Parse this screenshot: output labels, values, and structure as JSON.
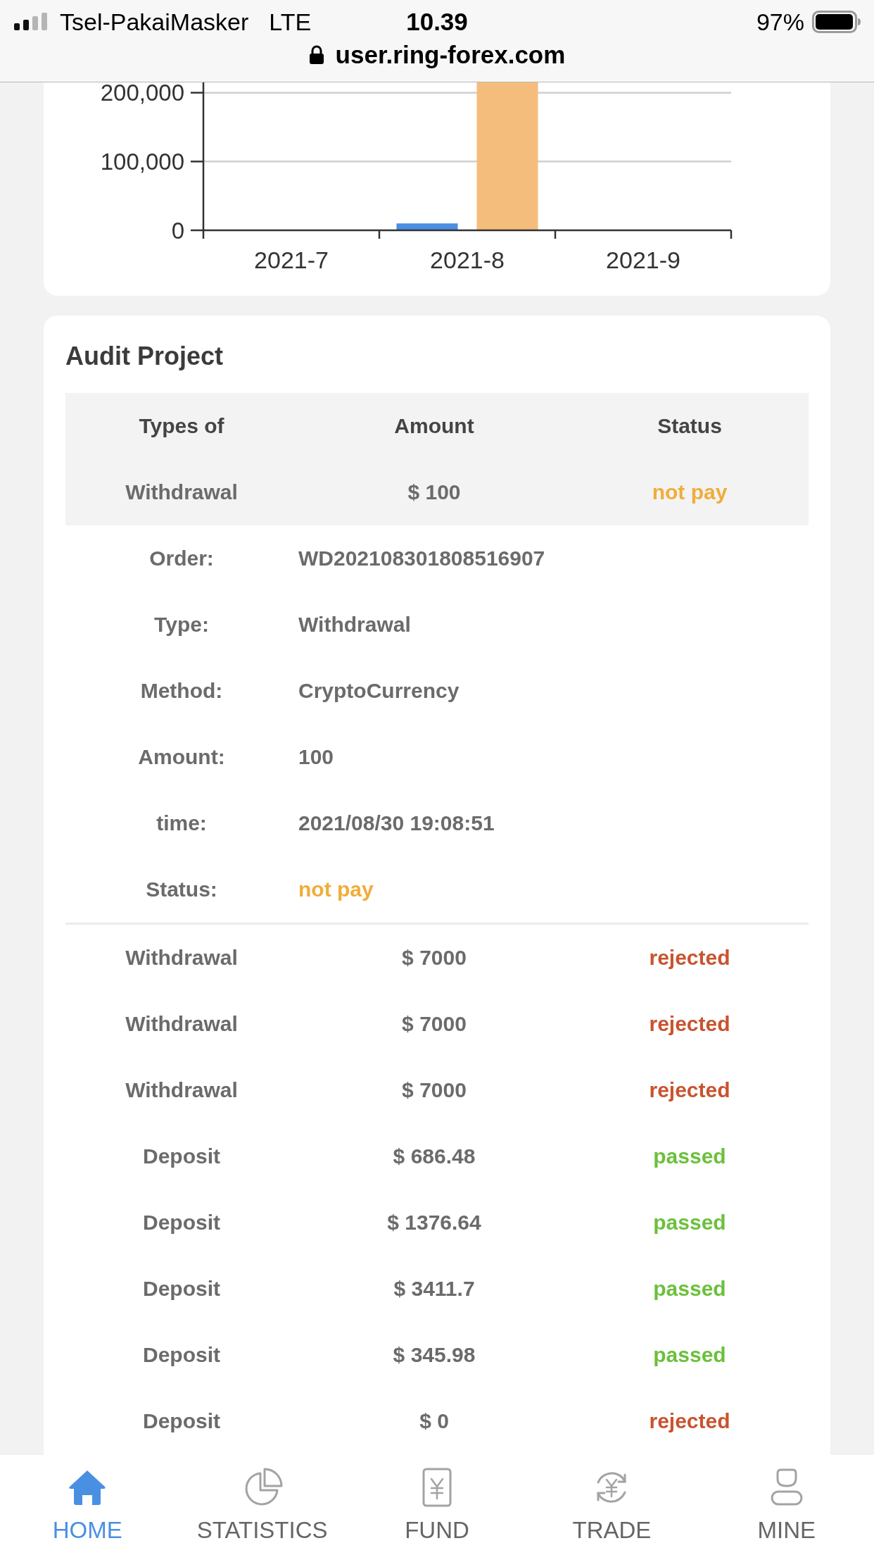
{
  "status_bar": {
    "carrier": "Tsel-PakaiMasker",
    "network": "LTE",
    "time": "10.39",
    "battery": "97%",
    "url": "user.ring-forex.com"
  },
  "chart_card": {
    "chart_data": {
      "type": "bar",
      "categories": [
        "2021-7",
        "2021-8",
        "2021-9"
      ],
      "series": [
        {
          "color": "#4a8fe0",
          "values": [
            null,
            10000,
            null
          ]
        },
        {
          "color": "#f5bd7b",
          "values": [
            null,
            215000,
            null
          ]
        }
      ],
      "ylim": [
        0,
        215000
      ],
      "yticks": [
        {
          "value": 0,
          "label": "0"
        },
        {
          "value": 100000,
          "label": "100,000"
        },
        {
          "value": 200000,
          "label": "200,000"
        }
      ]
    }
  },
  "audit_project": {
    "title": "Audit Project",
    "columns": [
      "Types of",
      "Amount",
      "Status"
    ],
    "rows": [
      {
        "type": "Withdrawal",
        "amount": "$ 100",
        "status": "not pay",
        "color": "#f0ad3a",
        "expanded": true,
        "details": [
          {
            "label": "Order:",
            "value": "WD202108301808516907"
          },
          {
            "label": "Type:",
            "value": "Withdrawal"
          },
          {
            "label": "Method:",
            "value": "CryptoCurrency"
          },
          {
            "label": "Amount:",
            "value": "100"
          },
          {
            "label": "time:",
            "value": "2021/08/30 19:08:51"
          },
          {
            "label": "Status:",
            "value": "not pay",
            "color": "#f0ad3a"
          }
        ]
      },
      {
        "type": "Withdrawal",
        "amount": "$ 7000",
        "status": "rejected",
        "color": "#c9532f",
        "expanded": false
      },
      {
        "type": "Withdrawal",
        "amount": "$ 7000",
        "status": "rejected",
        "color": "#c9532f",
        "expanded": false
      },
      {
        "type": "Withdrawal",
        "amount": "$ 7000",
        "status": "rejected",
        "color": "#c9532f",
        "expanded": false
      },
      {
        "type": "Deposit",
        "amount": "$ 686.48",
        "status": "passed",
        "color": "#6cc03c",
        "expanded": false
      },
      {
        "type": "Deposit",
        "amount": "$ 1376.64",
        "status": "passed",
        "color": "#6cc03c",
        "expanded": false
      },
      {
        "type": "Deposit",
        "amount": "$ 3411.7",
        "status": "passed",
        "color": "#6cc03c",
        "expanded": false
      },
      {
        "type": "Deposit",
        "amount": "$ 345.98",
        "status": "passed",
        "color": "#6cc03c",
        "expanded": false
      },
      {
        "type": "Deposit",
        "amount": "$ 0",
        "status": "rejected",
        "color": "#c9532f",
        "expanded": false
      }
    ]
  },
  "tab_bar": [
    {
      "label": "HOME",
      "selected": true
    },
    {
      "label": "STATISTICS",
      "selected": false
    },
    {
      "label": "FUND",
      "selected": false
    },
    {
      "label": "TRADE",
      "selected": false
    },
    {
      "label": "MINE",
      "selected": false
    }
  ]
}
